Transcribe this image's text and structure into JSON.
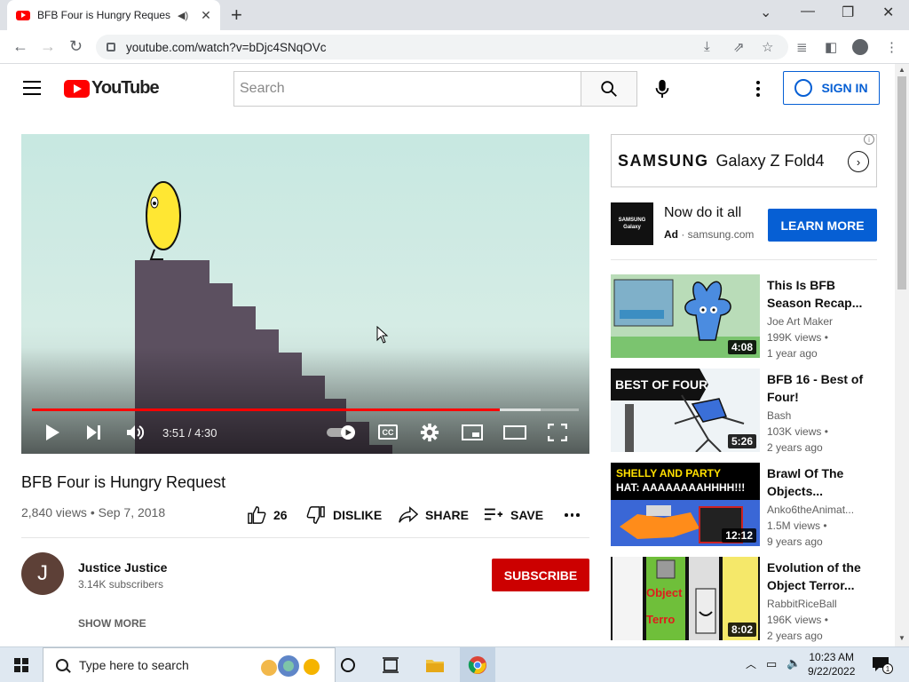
{
  "browser": {
    "tab_title": "BFB Four is Hungry Request",
    "url": "youtube.com/watch?v=bDjc4SNqOVc"
  },
  "header": {
    "logo_text": "YouTube",
    "search_placeholder": "Search",
    "sign_in": "SIGN IN"
  },
  "player": {
    "time": "3:51 / 4:30",
    "progress": 0.855,
    "buffered": 0.93
  },
  "video": {
    "title": "BFB Four is Hungry Request",
    "meta": "2,840 views • Sep 7, 2018",
    "likes": "26",
    "dislike_label": "DISLIKE",
    "share_label": "SHARE",
    "save_label": "SAVE"
  },
  "channel": {
    "initial": "J",
    "name": "Justice Justice",
    "subscribers": "3.14K subscribers",
    "subscribe_label": "SUBSCRIBE",
    "show_more": "SHOW MORE"
  },
  "ad": {
    "brand": "SAMSUNG",
    "product": "Galaxy Z Fold4",
    "logo_line1": "SAMSUNG",
    "logo_line2": "Galaxy",
    "headline": "Now do it all",
    "badge": "Ad",
    "domain": " · samsung.com",
    "cta": "LEARN MORE"
  },
  "recommendations": [
    {
      "title": "This Is BFB Season Recap...",
      "channel": "Joe Art Maker",
      "views": "199K views •",
      "date": "1 year ago",
      "duration": "4:08"
    },
    {
      "title": "BFB 16 - Best of Four!",
      "channel": "Bash",
      "views": "103K views •",
      "date": "2 years ago",
      "duration": "5:26",
      "thumb_text": "BEST OF FOUR"
    },
    {
      "title": "Brawl Of The Objects...",
      "channel": "Anko6theAnimat...",
      "views": "1.5M views •",
      "date": "9 years ago",
      "duration": "12:12",
      "thumb_text_a": "SHELLY AND PARTY",
      "thumb_text_b": "HAT: AAAAAAAAHHHH!!!"
    },
    {
      "title": "Evolution of the Object Terror...",
      "channel": "RabbitRiceBall",
      "views": "196K views •",
      "date": "2 years ago",
      "duration": "8:02",
      "thumb_text": "Object Terro"
    }
  ],
  "taskbar": {
    "search_placeholder": "Type here to search",
    "time": "10:23 AM",
    "date": "9/22/2022",
    "notification_count": "1"
  },
  "colors": {
    "youtube_red": "#ff0000",
    "subscribe_red": "#cc0000",
    "link_blue": "#065fd4"
  }
}
